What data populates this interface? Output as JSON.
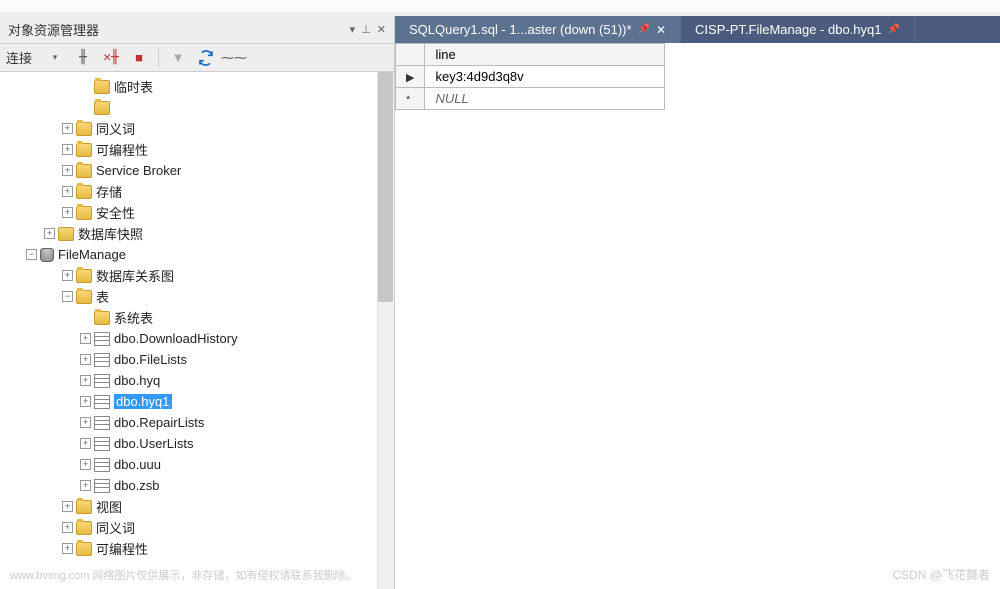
{
  "panel": {
    "title": "对象资源管理器",
    "dropdown_glyph": "▾",
    "pin_glyph": "⊥",
    "close_glyph": "✕"
  },
  "toolbar": {
    "connect_label": "连接",
    "dropdown_glyph": "▾"
  },
  "tree": {
    "items": [
      {
        "indent": 4,
        "expander": "none",
        "icon": "folder",
        "label": "临时表"
      },
      {
        "indent": 4,
        "expander": "none",
        "icon": "folder",
        "label": ""
      },
      {
        "indent": 3,
        "expander": "plus",
        "icon": "folder",
        "label": "同义词"
      },
      {
        "indent": 3,
        "expander": "plus",
        "icon": "folder",
        "label": "可编程性"
      },
      {
        "indent": 3,
        "expander": "plus",
        "icon": "folder",
        "label": "Service Broker"
      },
      {
        "indent": 3,
        "expander": "plus",
        "icon": "folder",
        "label": "存储"
      },
      {
        "indent": 3,
        "expander": "plus",
        "icon": "folder",
        "label": "安全性"
      },
      {
        "indent": 2,
        "expander": "plus",
        "icon": "snapshot",
        "label": "数据库快照"
      },
      {
        "indent": 1,
        "expander": "minus",
        "icon": "db",
        "label": "FileManage"
      },
      {
        "indent": 3,
        "expander": "plus",
        "icon": "folder",
        "label": "数据库关系图"
      },
      {
        "indent": 3,
        "expander": "minus",
        "icon": "folder",
        "label": "表"
      },
      {
        "indent": 4,
        "expander": "none",
        "icon": "folder",
        "label": "系统表"
      },
      {
        "indent": 4,
        "expander": "plus",
        "icon": "table",
        "label": "dbo.DownloadHistory"
      },
      {
        "indent": 4,
        "expander": "plus",
        "icon": "table",
        "label": "dbo.FileLists"
      },
      {
        "indent": 4,
        "expander": "plus",
        "icon": "table",
        "label": "dbo.hyq"
      },
      {
        "indent": 4,
        "expander": "plus",
        "icon": "table",
        "label": "dbo.hyq1",
        "selected": true
      },
      {
        "indent": 4,
        "expander": "plus",
        "icon": "table",
        "label": "dbo.RepairLists"
      },
      {
        "indent": 4,
        "expander": "plus",
        "icon": "table",
        "label": "dbo.UserLists"
      },
      {
        "indent": 4,
        "expander": "plus",
        "icon": "table",
        "label": "dbo.uuu"
      },
      {
        "indent": 4,
        "expander": "plus",
        "icon": "table",
        "label": "dbo.zsb"
      },
      {
        "indent": 3,
        "expander": "plus",
        "icon": "folder",
        "label": "视图"
      },
      {
        "indent": 3,
        "expander": "plus",
        "icon": "folder",
        "label": "同义词"
      },
      {
        "indent": 3,
        "expander": "plus",
        "icon": "folder",
        "label": "可编程性"
      }
    ]
  },
  "tabs": [
    {
      "label": "SQLQuery1.sql - 1...aster (down (51))*",
      "active": true
    },
    {
      "label": "CISP-PT.FileManage - dbo.hyq1",
      "active": false
    }
  ],
  "grid": {
    "column": "line",
    "rows": [
      {
        "indicator": "▶",
        "value": "key3:4d9d3q8v",
        "is_null": false
      },
      {
        "indicator": "*",
        "value": "NULL",
        "is_null": true
      }
    ]
  },
  "watermark": {
    "left": "www.bvimg.com 网络图片仅供展示，非存储，如有侵权请联系我删除。",
    "right": "CSDN @飞花舞者"
  }
}
